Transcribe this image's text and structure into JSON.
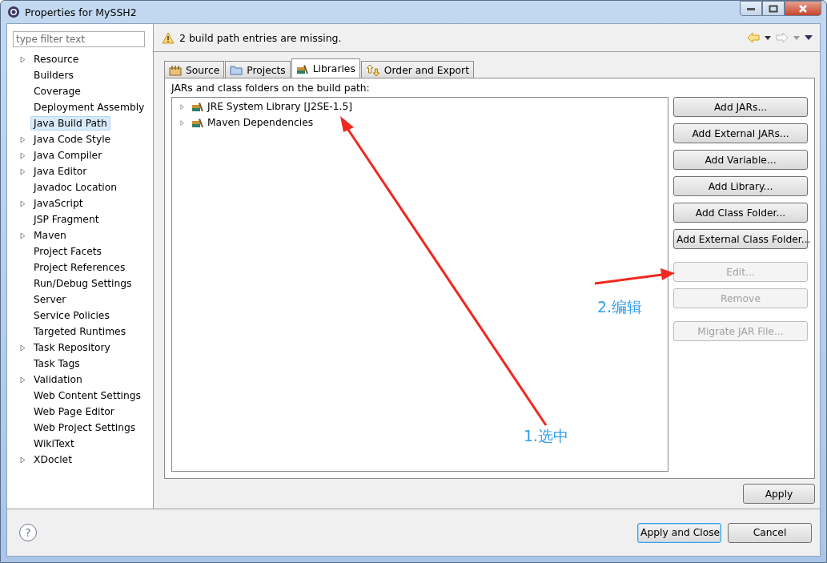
{
  "window": {
    "title": "Properties for MySSH2"
  },
  "filter": {
    "placeholder": "type filter text"
  },
  "sidebar": {
    "items": [
      {
        "label": "Resource",
        "expandable": true,
        "selected": false
      },
      {
        "label": "Builders",
        "expandable": false,
        "selected": false
      },
      {
        "label": "Coverage",
        "expandable": false,
        "selected": false
      },
      {
        "label": "Deployment Assembly",
        "expandable": false,
        "selected": false
      },
      {
        "label": "Java Build Path",
        "expandable": false,
        "selected": true
      },
      {
        "label": "Java Code Style",
        "expandable": true,
        "selected": false
      },
      {
        "label": "Java Compiler",
        "expandable": true,
        "selected": false
      },
      {
        "label": "Java Editor",
        "expandable": true,
        "selected": false
      },
      {
        "label": "Javadoc Location",
        "expandable": false,
        "selected": false
      },
      {
        "label": "JavaScript",
        "expandable": true,
        "selected": false
      },
      {
        "label": "JSP Fragment",
        "expandable": false,
        "selected": false
      },
      {
        "label": "Maven",
        "expandable": true,
        "selected": false
      },
      {
        "label": "Project Facets",
        "expandable": false,
        "selected": false
      },
      {
        "label": "Project References",
        "expandable": false,
        "selected": false
      },
      {
        "label": "Run/Debug Settings",
        "expandable": false,
        "selected": false
      },
      {
        "label": "Server",
        "expandable": false,
        "selected": false
      },
      {
        "label": "Service Policies",
        "expandable": false,
        "selected": false
      },
      {
        "label": "Targeted Runtimes",
        "expandable": false,
        "selected": false
      },
      {
        "label": "Task Repository",
        "expandable": true,
        "selected": false
      },
      {
        "label": "Task Tags",
        "expandable": false,
        "selected": false
      },
      {
        "label": "Validation",
        "expandable": true,
        "selected": false
      },
      {
        "label": "Web Content Settings",
        "expandable": false,
        "selected": false
      },
      {
        "label": "Web Page Editor",
        "expandable": false,
        "selected": false
      },
      {
        "label": "Web Project Settings",
        "expandable": false,
        "selected": false
      },
      {
        "label": "WikiText",
        "expandable": false,
        "selected": false
      },
      {
        "label": "XDoclet",
        "expandable": true,
        "selected": false
      }
    ]
  },
  "message": "2 build path entries are missing.",
  "tabs": [
    {
      "label": "Source",
      "kind": "source",
      "selected": false
    },
    {
      "label": "Projects",
      "kind": "projects",
      "selected": false
    },
    {
      "label": "Libraries",
      "kind": "libraries",
      "selected": true
    },
    {
      "label": "Order and Export",
      "kind": "order",
      "selected": false
    }
  ],
  "libraries": {
    "caption": "JARs and class folders on the build path:",
    "entries": [
      {
        "label": "JRE System Library [J2SE-1.5]",
        "expanded": false
      },
      {
        "label": "Maven Dependencies",
        "expanded": false
      }
    ],
    "button_groups": [
      [
        {
          "label": "Add JARs...",
          "disabled": false
        },
        {
          "label": "Add External JARs...",
          "disabled": false
        },
        {
          "label": "Add Variable...",
          "disabled": false
        },
        {
          "label": "Add Library...",
          "disabled": false
        },
        {
          "label": "Add Class Folder...",
          "disabled": false
        },
        {
          "label": "Add External Class Folder...",
          "disabled": false
        }
      ],
      [
        {
          "label": "Edit...",
          "disabled": true
        },
        {
          "label": "Remove",
          "disabled": true
        }
      ],
      [
        {
          "label": "Migrate JAR File...",
          "disabled": true
        }
      ]
    ]
  },
  "apply_button": "Apply",
  "footer": {
    "help": "?",
    "buttons": [
      {
        "label": "Apply and Close",
        "default": true
      },
      {
        "label": "Cancel",
        "default": false
      }
    ]
  },
  "annotations": [
    {
      "label": "1.选中"
    },
    {
      "label": "2.编辑"
    }
  ]
}
